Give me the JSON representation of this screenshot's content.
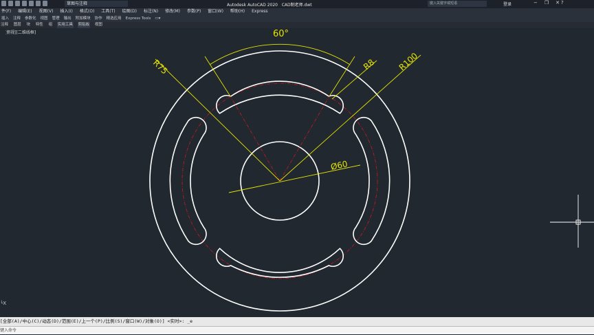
{
  "title_bar": {
    "workspace": "草图与注释",
    "app_title": "Autodesk AutoCAD 2020",
    "file_name": "CAD制老师.dwt",
    "search_placeholder": "键入关键字或短语",
    "login": "登录",
    "minimize": "−",
    "restore": "❐",
    "close": "✕",
    "help": "?"
  },
  "menu": [
    "件(F)",
    "编辑(E)",
    "视图(V)",
    "插入(I)",
    "格式(O)",
    "工具(T)",
    "绘图(D)",
    "标注(N)",
    "修改(M)",
    "参数(P)",
    "窗口(W)",
    "帮助(H)",
    "Express"
  ],
  "ribbon_tabs": [
    "插入",
    "注释",
    "参数化",
    "视图",
    "管理",
    "输出",
    "附加模块",
    "协作",
    "精选应用",
    "Express Tools"
  ],
  "panels": [
    "注释",
    "图层",
    "块",
    "特性",
    "组",
    "实用工具",
    "剪贴板",
    "视图"
  ],
  "viewport_label": "[-][俯视][二维线框]",
  "drawing": {
    "dimensions": {
      "angle": "60°",
      "slot_radius": "R8",
      "outer_radius": "R100",
      "center_radius": "R75",
      "hole_diameter": "Ø60"
    },
    "colors": {
      "background": "#212830",
      "geometry": "#ffffff",
      "dimension": "#e6e600",
      "centerline": "#cc1a1a"
    }
  },
  "ucs_icon_text": "└X",
  "command_line": {
    "history": "[全部(A)/中心(C)/动态(D)/范围(E)/上一个(P)/比例(S)/窗口(W)/对象(O)] <实时>: _e",
    "prompt": "键入命令"
  }
}
